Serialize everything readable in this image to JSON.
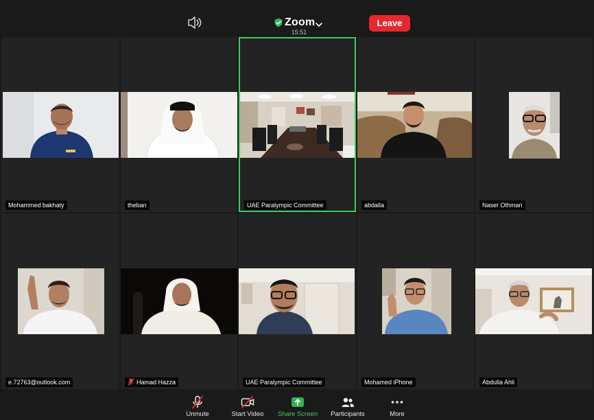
{
  "header": {
    "app_title": "Zoom",
    "time": "15:51",
    "leave_label": "Leave",
    "speaker_icon": "speaker-icon",
    "security_icon": "shield-check-icon"
  },
  "participants": [
    {
      "name": "Mohammed bakhaty"
    },
    {
      "name": "theban"
    },
    {
      "name": "UAE Paralympic Committee",
      "active_speaker": true
    },
    {
      "name": "abdalla"
    },
    {
      "name": "Naser Othman"
    },
    {
      "name": "e.72763@outlook.com"
    },
    {
      "name": "Hamad Hazza",
      "muted": true
    },
    {
      "name": "UAE Paralympic Committee"
    },
    {
      "name": "Mohamed iPhone"
    },
    {
      "name": "Abdulla Ahli"
    }
  ],
  "toolbar": {
    "unmute": "Unmute",
    "start_video": "Start Video",
    "share_screen": "Share Screen",
    "participants": "Participants",
    "more": "More"
  },
  "colors": {
    "background": "#1a1a1a",
    "tile": "#232323",
    "active_border": "#3ccf5a",
    "leave": "#e5292e",
    "share": "#45c760"
  }
}
